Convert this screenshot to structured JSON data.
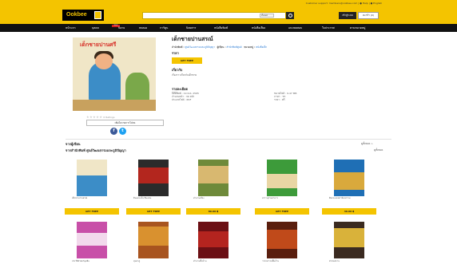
{
  "topbar": {
    "links": "Customer support: members@ookbee.com | ● Help | ● English"
  },
  "header": {
    "logo": "Ookbee",
    "search_placeholder": "",
    "search_select": "ทั้งหมด",
    "login": "เข้าสู่ระบบ",
    "cart": "ตะกร้า (0)"
  },
  "nav": {
    "items": [
      "หน้าแรก",
      "บุคคล",
      "นิยาย",
      "ทดลอง",
      "การ์ตูน",
      "นิตยสาร",
      "หนังสือพิมพ์",
      "หนังสือเสียง",
      "แบบทดสอบ",
      "ใบประกาศ",
      "ตามหมวดหมู่"
    ],
    "badge": "NEW"
  },
  "book": {
    "cover_title": "เด็กชายปานศรี",
    "title": "เด็กชายปานสรณ์",
    "author_label": "สำนักพิมพ์ :",
    "author": "ศูนย์วัฒนธรรมและภูมิปัญญา",
    "category_label": "หมวดหมู่ :",
    "category": "หนังสือเด็ก",
    "publisher_label": "ผู้เขียน :",
    "publisher": "สำนักพิมพ์ศูนย์",
    "price_label": "ราคา",
    "get_free": "GET FREE",
    "desc_heading": "เกี่ยวกับ",
    "desc": "เรื่องราวเกี่ยวกับเด็กชาย",
    "details_heading": "รายละเอียด",
    "details": [
      "ปีที่ตีพิมพ์ : 19 ต.ค. 2565",
      "ขนาดไฟล์ : 9.47 MB",
      "จำนวนหน้า : 36 หน้า",
      "ภาษา : TH",
      "ประเภทไฟล์ : PDF",
      "ราคา : ฟรี"
    ],
    "rating": "0 Ratings",
    "wishlist": "เพิ่มในรายการโปรด",
    "facebook": "f",
    "twitter": "t"
  },
  "lists": {
    "section1_title": "จากผู้เขียน",
    "section1_more": "ดูทั้งหมด >",
    "section2_title": "จากสำนักพิมพ์ ศูนย์วัฒนธรรมและภูมิปัญญา",
    "section2_more": "ดูทั้งหมด"
  },
  "cards": [
    {
      "text": "เด็กชายปานสรณ์",
      "btn": "GET FREE"
    },
    {
      "text": "ดินแดน ต้น ดินแดน",
      "btn": "GET FREE"
    },
    {
      "text": "ตำนานเมือง",
      "btn": "80.00 ฿"
    },
    {
      "text": "สารานุกรมอาหาร",
      "btn": "GET FREE"
    },
    {
      "text": "ศิลปะและสถาปัตยกรรม",
      "btn": "40.00 ฿"
    },
    {
      "text": "ประวัติศาสตร์มุสลิม",
      "btn": ""
    },
    {
      "text": "สุนทรภู่",
      "btn": ""
    },
    {
      "text": "ตำนานพื้นบ้าน",
      "btn": ""
    },
    {
      "text": "วรรณกรรมพื้นบ้าน",
      "btn": ""
    },
    {
      "text": "ศาสนสถาน",
      "btn": ""
    }
  ]
}
